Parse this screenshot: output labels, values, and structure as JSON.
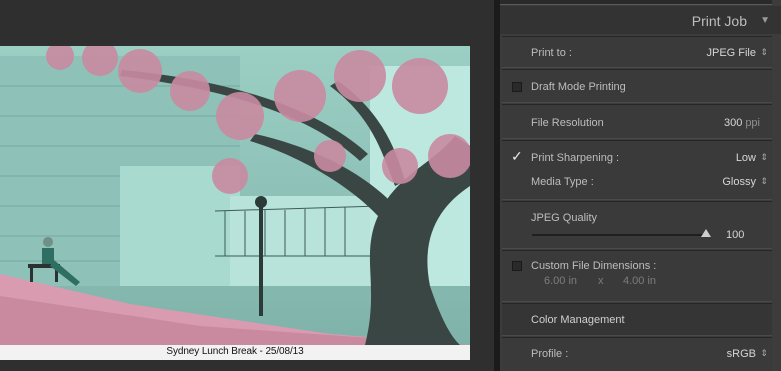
{
  "canvas": {
    "caption": "Sydney Lunch Break - 25/08/13"
  },
  "panel": {
    "title": "Print Job",
    "collapse_icon": "▼",
    "print_to": {
      "label": "Print to :",
      "value": "JPEG File"
    },
    "draft_mode": {
      "label": "Draft Mode Printing",
      "checked": false
    },
    "file_resolution": {
      "label": "File Resolution",
      "value": "300",
      "unit": "ppi"
    },
    "print_sharpening": {
      "label": "Print Sharpening :",
      "checked": true,
      "value": "Low"
    },
    "media_type": {
      "label": "Media Type :",
      "value": "Glossy"
    },
    "jpeg_quality": {
      "label": "JPEG Quality",
      "value": "100",
      "fraction": 1.0
    },
    "custom_dims": {
      "label": "Custom File Dimensions :",
      "checked": false,
      "width": "6.00 in",
      "x": "x",
      "height": "4.00 in"
    },
    "color_management": {
      "label": "Color Management"
    },
    "profile": {
      "label": "Profile :",
      "value": "sRGB"
    }
  },
  "colors": {
    "panel_bg": "#3a3a3a",
    "blossom": "#c98aa0",
    "sky_teal": "#a8d8cf"
  }
}
